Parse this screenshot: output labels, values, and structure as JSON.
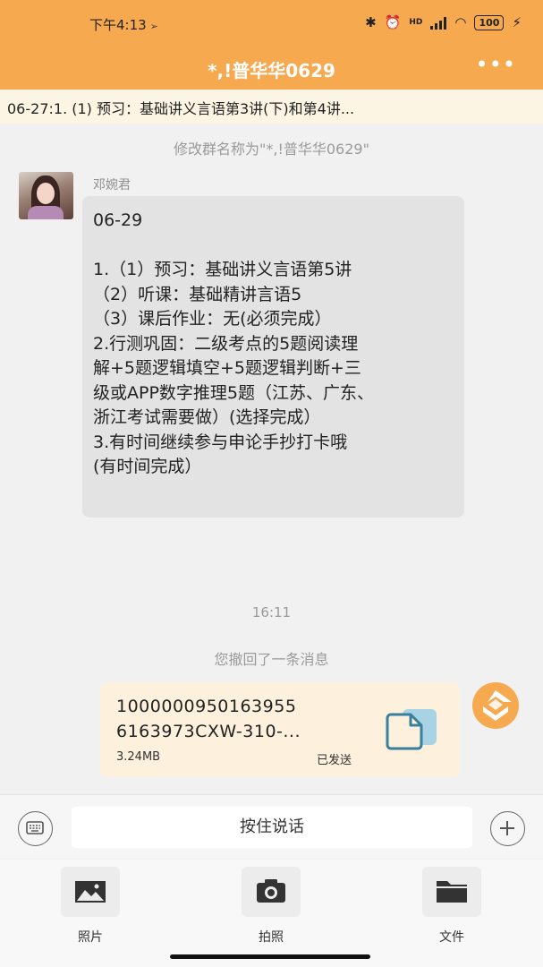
{
  "status_bar": {
    "time": "下午4:13",
    "nav_arrow": "➢",
    "bluetooth": "✱",
    "alarm": "⏰",
    "hd": "HD",
    "wifi": "◠",
    "battery": "100",
    "charging": "⚡"
  },
  "header": {
    "title": "*,!普华华0629",
    "more": "•••",
    "background": "#f6a94e"
  },
  "pinned": {
    "text": "06-27:1. (1) 预习：基础讲义言语第3讲(下)和第4讲..."
  },
  "chat": {
    "rename_notice": "修改群名称为\"*,!普华华0629\"",
    "sender_name": "邓婉君",
    "message_lines": [
      "06-29",
      "",
      "1.（1）预习：基础讲义言语第5讲",
      "（2）听课：基础精讲言语5",
      "（3）课后作业：无(必须完成）",
      "2.行测巩固：二级考点的5题阅读理",
      "解+5题逻辑填空+5题逻辑判断+三",
      "级或APP数字推理5题（江苏、广东、",
      "浙江考试需要做）(选择完成）",
      "3.有时间继续参与申论手抄打卡哦",
      "(有时间完成）"
    ],
    "timestamp": "16:11",
    "recall_notice": "您撤回了一条消息",
    "file": {
      "name_line1": "1000000950163955",
      "name_line2": "6163973CXW-310-...",
      "size": "3.24MB",
      "status": "已发送"
    }
  },
  "input_bar": {
    "voice_label": "按住说话"
  },
  "attach_panel": {
    "items": [
      {
        "label": "照片",
        "icon": "image-icon"
      },
      {
        "label": "拍照",
        "icon": "camera-icon"
      },
      {
        "label": "文件",
        "icon": "folder-icon"
      }
    ]
  },
  "colors": {
    "accent": "#f6a94e",
    "bubble": "#e3e3e3",
    "file_card": "#fdf0dc",
    "file_icon": "#3a7f9c"
  }
}
